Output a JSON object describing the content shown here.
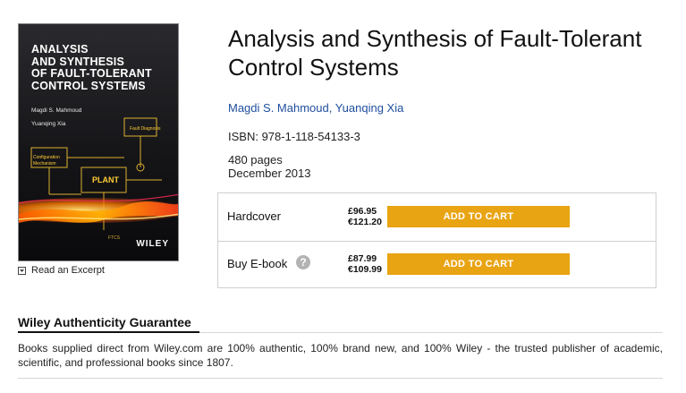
{
  "cover": {
    "title": "ANALYSIS\nAND SYNTHESIS\nOF FAULT-TOLERANT\nCONTROL SYSTEMS",
    "author1": "Magdi S. Mahmoud",
    "author2": "Yuanqing Xia",
    "publisher": "WILEY",
    "diagram_labels": [
      "Fault Diagnosis",
      "Configuration Mechanism",
      "PLANT",
      "FTCS"
    ],
    "colors": {
      "background": "#1b1b1f",
      "flame": "#ff7a00",
      "accent": "#ffd34a"
    }
  },
  "excerpt": {
    "label": "Read an Excerpt",
    "icon": "chevron-down-icon"
  },
  "book": {
    "title": "Analysis and Synthesis of Fault-Tolerant Control Systems",
    "authors": "Magdi S. Mahmoud, Yuanqing Xia",
    "isbn": "ISBN: 978-1-118-54133-3",
    "pages": "480 pages",
    "date": "December 2013"
  },
  "formats": [
    {
      "name": "Hardcover",
      "price_gbp": "£96.95",
      "price_eur": "€121.20",
      "button": "ADD TO CART",
      "help": false
    },
    {
      "name": "Buy E-book",
      "price_gbp": "£87.99",
      "price_eur": "€109.99",
      "button": "ADD TO CART",
      "help": true,
      "help_icon": "question-mark-icon"
    }
  ],
  "guarantee": {
    "heading": "Wiley Authenticity Guarantee",
    "text": "Books supplied direct from Wiley.com are 100% authentic, 100% brand new, and 100% Wiley - the trusted publisher of academic, scientific, and professional books since 1807."
  },
  "theme": {
    "button_color": "#e9a413",
    "link_color": "#1f4e9e"
  }
}
